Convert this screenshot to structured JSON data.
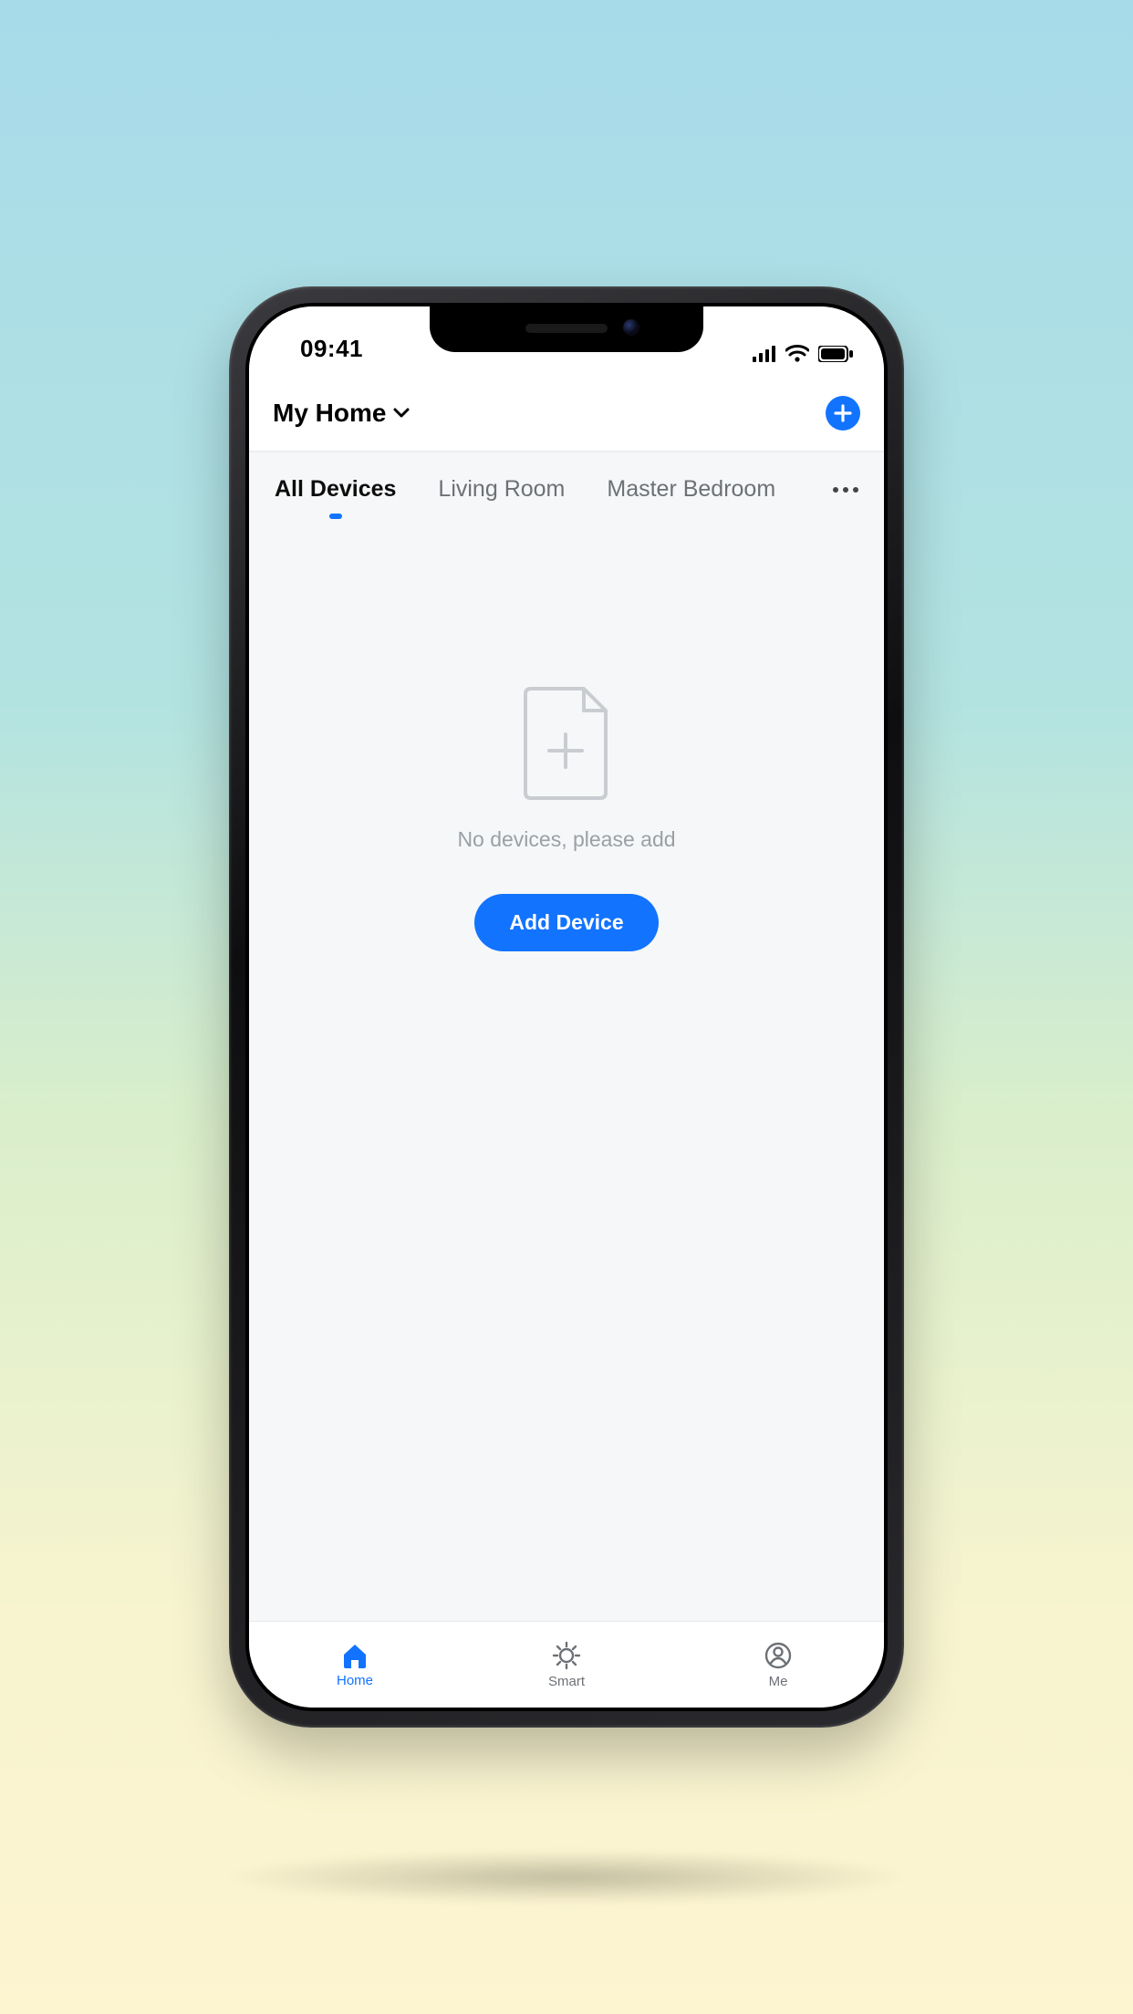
{
  "status": {
    "time": "09:41"
  },
  "header": {
    "title": "My Home"
  },
  "tabs": {
    "items": [
      {
        "label": "All Devices",
        "active": true
      },
      {
        "label": "Living Room",
        "active": false
      },
      {
        "label": "Master Bedroom",
        "active": false
      }
    ]
  },
  "empty": {
    "message": "No devices, please add",
    "button": "Add Device"
  },
  "nav": {
    "items": [
      {
        "label": "Home",
        "active": true
      },
      {
        "label": "Smart",
        "active": false
      },
      {
        "label": "Me",
        "active": false
      }
    ]
  },
  "colors": {
    "accent": "#1273ff"
  }
}
